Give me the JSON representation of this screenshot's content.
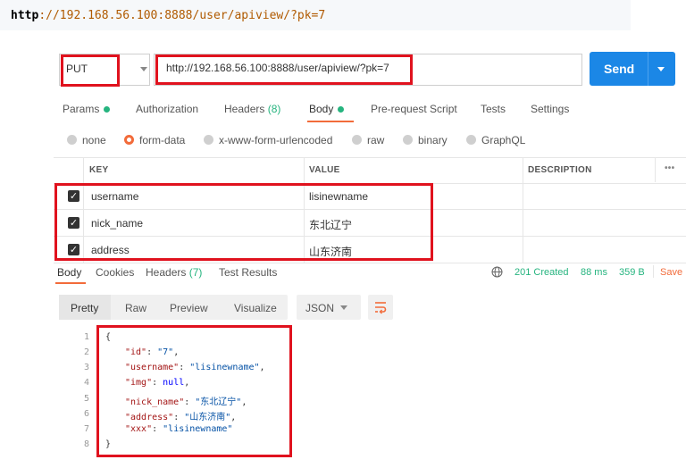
{
  "top_url": {
    "prefix": "http",
    "rest": "://192.168.56.100:8888/user/apiview/?pk=7"
  },
  "request": {
    "method": "PUT",
    "url": "http://192.168.56.100:8888/user/apiview/?pk=7",
    "send_label": "Send"
  },
  "req_tabs": {
    "params": "Params",
    "authorization": "Authorization",
    "headers": "Headers",
    "headers_count": "(8)",
    "body": "Body",
    "prerequest": "Pre-request Script",
    "tests": "Tests",
    "settings": "Settings"
  },
  "body_types": [
    "none",
    "form-data",
    "x-www-form-urlencoded",
    "raw",
    "binary",
    "GraphQL"
  ],
  "table": {
    "headers": [
      "KEY",
      "VALUE",
      "DESCRIPTION"
    ],
    "more": "•••",
    "rows": [
      {
        "key": "username",
        "value": "lisinewname"
      },
      {
        "key": "nick_name",
        "value": "东北辽宁"
      },
      {
        "key": "address",
        "value": "山东济南"
      }
    ]
  },
  "resp_tabs": {
    "body": "Body",
    "cookies": "Cookies",
    "headers": "Headers",
    "headers_count": "(7)",
    "test_results": "Test Results"
  },
  "status": {
    "code": "201 Created",
    "time": "88 ms",
    "size": "359 B",
    "save": "Save"
  },
  "view_modes": [
    "Pretty",
    "Raw",
    "Preview",
    "Visualize"
  ],
  "format": "JSON",
  "response_lines": [
    {
      "n": "1",
      "text": "{"
    },
    {
      "n": "2",
      "key": "\"id\"",
      "val": "\"7\"",
      "comma": ","
    },
    {
      "n": "3",
      "key": "\"username\"",
      "val": "\"lisinewname\"",
      "comma": ","
    },
    {
      "n": "4",
      "key": "\"img\"",
      "val": "null",
      "comma": ","
    },
    {
      "n": "5",
      "key": "\"nick_name\"",
      "val": "\"东北辽宁\"",
      "comma": ","
    },
    {
      "n": "6",
      "key": "\"address\"",
      "val": "\"山东济南\"",
      "comma": ","
    },
    {
      "n": "7",
      "key": "\"xxx\"",
      "val": "\"lisinewname\"",
      "comma": ""
    },
    {
      "n": "8",
      "text": "}"
    }
  ],
  "colors": {
    "accent": "#f26b3a",
    "send": "#1b87e6",
    "success": "#26b47f",
    "highlight": "#e0121e"
  }
}
